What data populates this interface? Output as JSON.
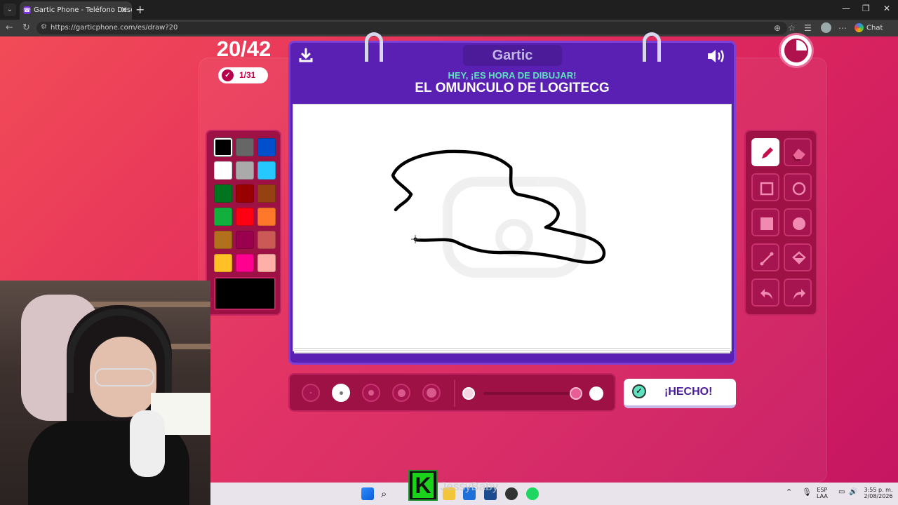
{
  "browser": {
    "tab_title": "Gartic Phone - Teléfono Descomp",
    "url": "https://garticphone.com/es/draw?20",
    "chat_label": "Chat"
  },
  "game": {
    "round": "20/42",
    "score": "1/31",
    "logo_text": "Gartic",
    "prompt_subtitle": "HEY, ¡ES HORA DE DIBUJAR!",
    "prompt_title": "EL OMUNCULO DE LOGITECG",
    "done_label": "¡HECHO!",
    "palette": [
      "#000000",
      "#666666",
      "#0050cd",
      "#ffffff",
      "#aaaaaa",
      "#26c9ff",
      "#017420",
      "#990000",
      "#964112",
      "#11b03c",
      "#ff0013",
      "#ff7829",
      "#b0701c",
      "#99004e",
      "#cb5a57",
      "#ffc126",
      "#ff008f",
      "#feafa8"
    ],
    "selected_color": "#000000",
    "tools": [
      "pencil-icon",
      "eraser-icon",
      "square-outline-icon",
      "circle-outline-icon",
      "square-filled-icon",
      "circle-filled-icon",
      "line-icon",
      "fill-bucket-icon",
      "undo-icon",
      "redo-icon"
    ],
    "brush_sizes": 5,
    "selected_brush": 2
  },
  "taskbar": {
    "language": "ESP",
    "language_sub": "LAA",
    "time": "3:55 p. m.",
    "date": "2/08/2026"
  },
  "overlay": {
    "streamer_letter": "K",
    "streamer_name": "JessyBaby"
  }
}
